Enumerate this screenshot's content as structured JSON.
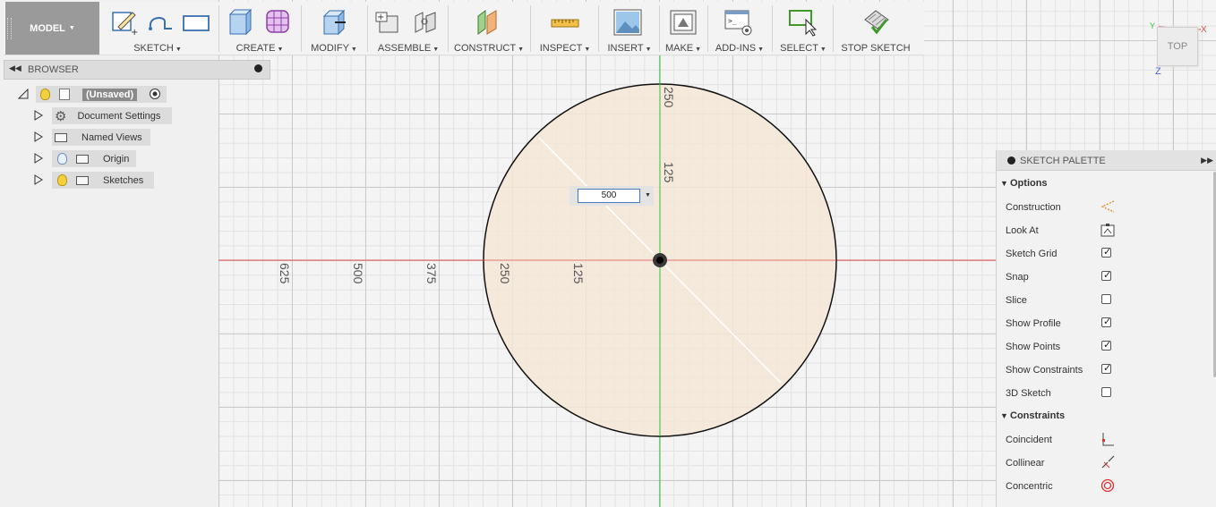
{
  "toolbar": {
    "model": "MODEL",
    "groups": [
      {
        "label": "SKETCH"
      },
      {
        "label": "CREATE"
      },
      {
        "label": "MODIFY"
      },
      {
        "label": "ASSEMBLE"
      },
      {
        "label": "CONSTRUCT"
      },
      {
        "label": "INSPECT"
      },
      {
        "label": "INSERT"
      },
      {
        "label": "MAKE"
      },
      {
        "label": "ADD-INS"
      },
      {
        "label": "SELECT"
      },
      {
        "label": "STOP SKETCH"
      }
    ]
  },
  "browser": {
    "title": "BROWSER",
    "root": "(Unsaved)",
    "items": [
      {
        "label": "Document Settings",
        "icon": "gear-icon"
      },
      {
        "label": "Named Views",
        "icon": "folder-icon"
      },
      {
        "label": "Origin",
        "icon": "folder-icon"
      },
      {
        "label": "Sketches",
        "icon": "folder-icon"
      }
    ]
  },
  "canvas": {
    "dimension_value": "500",
    "axis_labels_horizontal": [
      "625",
      "500",
      "375",
      "250",
      "125"
    ],
    "axis_labels_vertical": [
      "250",
      "125"
    ],
    "colors": {
      "x_axis": "#e05050",
      "y_axis": "#36c236",
      "circle_fill": "#f5e6d6",
      "circle_stroke": "#111111"
    }
  },
  "viewcube": {
    "face": "TOP",
    "x": "X",
    "y": "Y",
    "z": "Z"
  },
  "palette": {
    "title": "SKETCH PALETTE",
    "options_header": "Options",
    "options": [
      {
        "label": "Construction",
        "type": "icon",
        "icon": "construction-icon"
      },
      {
        "label": "Look At",
        "type": "icon",
        "icon": "look-at-icon"
      },
      {
        "label": "Sketch Grid",
        "type": "check",
        "checked": true
      },
      {
        "label": "Snap",
        "type": "check",
        "checked": true
      },
      {
        "label": "Slice",
        "type": "check",
        "checked": false
      },
      {
        "label": "Show Profile",
        "type": "check",
        "checked": true
      },
      {
        "label": "Show Points",
        "type": "check",
        "checked": true
      },
      {
        "label": "Show Constraints",
        "type": "check",
        "checked": true
      },
      {
        "label": "3D Sketch",
        "type": "check",
        "checked": false
      }
    ],
    "constraints_header": "Constraints",
    "constraints": [
      {
        "label": "Coincident",
        "icon": "coincident-icon"
      },
      {
        "label": "Collinear",
        "icon": "collinear-icon"
      },
      {
        "label": "Concentric",
        "icon": "concentric-icon"
      }
    ]
  }
}
